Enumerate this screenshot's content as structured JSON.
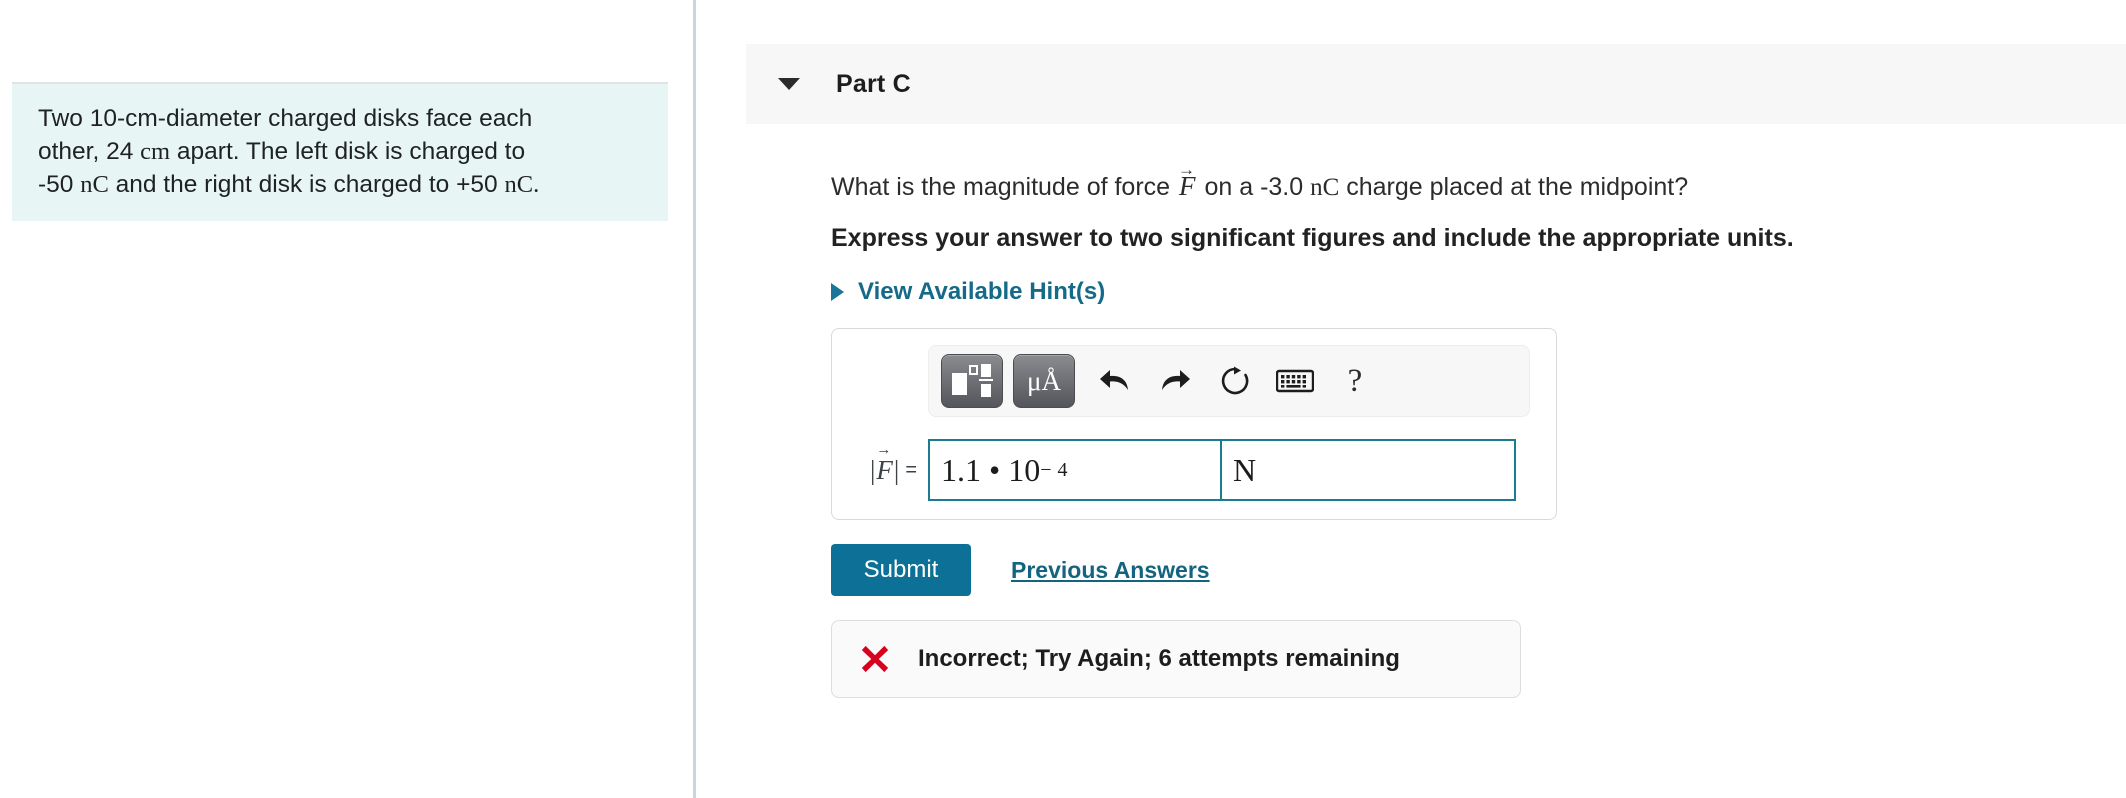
{
  "problem": {
    "line1_a": "Two 10-cm-diameter charged disks face each",
    "line2_a": "other, 24 ",
    "line2_unit": "cm",
    "line2_b": " apart. The left disk is charged to",
    "line3_a": "-50 ",
    "line3_unit1": "nC",
    "line3_b": " and the right disk is charged to  +50 ",
    "line3_unit2": "nC",
    "line3_c": "."
  },
  "part": {
    "title": "Part C",
    "caret_icon": "caret-down-icon"
  },
  "question": {
    "text_before": "What is the magnitude of force ",
    "symbol": "F",
    "symbol_arrow": "→",
    "text_middle": " on a -3.0 ",
    "unit": "nC",
    "text_after": " charge placed at the midpoint?",
    "instruction": "Express your answer to two significant figures and include the appropriate units."
  },
  "hints": {
    "label": "View Available Hint(s)",
    "caret_icon": "caret-right-icon"
  },
  "toolbar": {
    "template_button": "template-icon",
    "units_button": "μÅ",
    "undo": "undo-icon",
    "redo": "redo-icon",
    "reset": "reset-icon",
    "keyboard": "keyboard-icon",
    "help": "?"
  },
  "answer": {
    "label_symbol": "F",
    "label_arrow": "→",
    "label_bar_left": "|",
    "label_bar_right": "|",
    "equals": "=",
    "value_mantissa": "1.1 • 10",
    "value_exponent": "− 4",
    "value_full": "1.1 • 10^-4",
    "unit_value": "N",
    "value_placeholder": "",
    "unit_placeholder": ""
  },
  "actions": {
    "submit_label": "Submit",
    "previous_answers_label": "Previous Answers"
  },
  "feedback": {
    "icon": "x-mark-icon",
    "message": "Incorrect; Try Again; 6 attempts remaining"
  },
  "colors": {
    "accent_teal": "#0d7197",
    "link_teal": "#13647f",
    "field_border": "#1c7b91",
    "problem_bg": "#e7f5f4",
    "error_red": "#d8001f",
    "header_bg": "#f7f7f7"
  }
}
